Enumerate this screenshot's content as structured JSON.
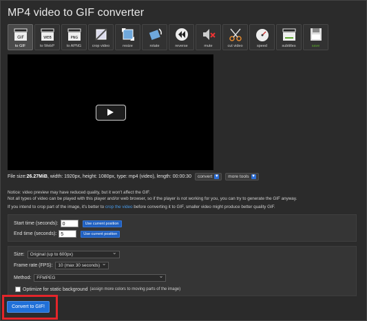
{
  "page": {
    "title": "MP4 video to GIF converter"
  },
  "toolbar": {
    "items": [
      {
        "label": "to GIF",
        "icon": "clapper-gif-icon"
      },
      {
        "label": "to WebP",
        "icon": "clapper-webp-icon"
      },
      {
        "label": "to APNG",
        "icon": "clapper-apng-icon"
      },
      {
        "label": "crop video",
        "icon": "crop-icon"
      },
      {
        "label": "resize",
        "icon": "resize-icon"
      },
      {
        "label": "rotate",
        "icon": "rotate-icon"
      },
      {
        "label": "reverse",
        "icon": "reverse-icon"
      },
      {
        "label": "mute",
        "icon": "mute-icon"
      },
      {
        "label": "cut video",
        "icon": "scissors-icon"
      },
      {
        "label": "speed",
        "icon": "speed-icon"
      },
      {
        "label": "subtitles",
        "icon": "subtitles-icon"
      },
      {
        "label": "save",
        "icon": "save-icon"
      }
    ]
  },
  "fileinfo": {
    "size_prefix": "File size: ",
    "size_value": "26.27MiB",
    "details": ", width: 1920px, height: 1080px, type: mp4 (video), length: 00:00:30",
    "convert_label": "convert",
    "more_tools_label": "more tools"
  },
  "notes": {
    "line1": "Notice: video preview may have reduced quality, but it won't affect the GIF.",
    "line2": "Not all types of video can be played with this player and/or web browser, so if the player is not working for you, you can try to generate the GIF anyway.",
    "line3_before": "If you intend to crop part of the image, it's better to ",
    "line3_link": "crop the video",
    "line3_after": " before converting it to GIF, smaller video might produce better quality GIF."
  },
  "time": {
    "start_label": "Start time (seconds):",
    "start_value": "0",
    "end_label": "End time (seconds):",
    "end_value": "5",
    "use_position_label": "Use current position"
  },
  "options": {
    "size_label": "Size:",
    "size_value": "Original (up to 600px)",
    "fps_label": "Frame rate (FPS):",
    "fps_value": "10 (max 30 seconds)",
    "method_label": "Method:",
    "method_value": "FFMPEG",
    "optimize_label": "Optimize for static background",
    "optimize_hint": "(assign more colors to moving parts of the image)",
    "optimize_checked": false
  },
  "actions": {
    "convert_label": "Convert to GIF!"
  },
  "colors": {
    "accent": "#2070d8",
    "highlight": "#e5252a",
    "link": "#4a9be8"
  }
}
